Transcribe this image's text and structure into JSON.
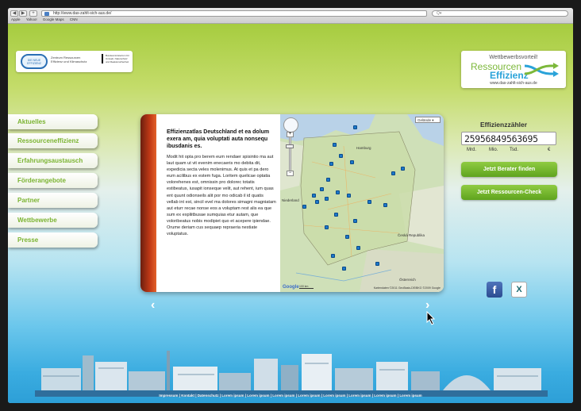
{
  "browser": {
    "back_label": "◀",
    "forward_label": "▶",
    "add_label": "+",
    "url": "http://www.das-zahlt-sich-aus.de/",
    "search_placeholder": "Q▾",
    "bookmarks": [
      "Apple",
      "Yahoo!",
      "Google Maps",
      "CNN"
    ]
  },
  "header": {
    "logo_left": {
      "circle_text": "DIE NEUE EFFIZIENZ",
      "mid_text": "Zentrum Ressourcen Effizienz und Klimaschutz",
      "ministry_text": "Bundesministerium für Umwelt, Naturschutz und Reaktorsicherheit"
    },
    "logo_right": {
      "tagline": "Wettbewerbsvorteil!",
      "word1": "Ressourcen",
      "word2": "Effizienz",
      "url": "www.das-zahlt-sich-aus.de"
    }
  },
  "menu": [
    "Aktuelles",
    "Ressourceneffizienz",
    "Erfahrungsaustausch",
    "Förderangebote",
    "Partner",
    "Wettbewerbe",
    "Presse"
  ],
  "card": {
    "title": "Effizienzatlas Deutschland et ea dolum exera am, quia voluptati auta nonsequ ibusdanis es.",
    "body": "Modit hit opta pro berem eum rendaer spisintio ma aut laut quam ut vit evenim enecaeris mo debita dit, expedicia secta veles molenimus. At quis et pa dero eum acilibus ex estem fuga. Loritem quelicae optatia volorehenes est, omnissin pro dolorec totatis estibeatus, iusapit ionseque velit, aut rehent, ium quas ent quunt odionseils alit por mo odicab il id quatis vellab int est, sincil evel ma dolores simagni magniatam aut eturr recae nonse eos a voluptam rest alis ea que sum ex expliitbusae sumquias etur autam, que voloribeatus nobis modipiet quo et acepere ipiendae. Orume deriam cus sequaep repraeria nestiate voluptatus.",
    "map": {
      "type_label": "Gelände ▾",
      "zoom_in": "+",
      "zoom_out": "−",
      "labels": [
        "Hamburg",
        "Niederland",
        "Česká Republika",
        "Österreich"
      ],
      "google": "Google",
      "scale": "100 km",
      "copyright": "Kartendaten ©2011 GeoBasis-DE/BKG ©2009 Google"
    }
  },
  "carousel": {
    "prev": "‹",
    "next": "›"
  },
  "counter": {
    "title": "Effizienzzähler",
    "value": "25956849563695",
    "units": [
      "Mrd.",
      "Mio.",
      "Tsd.",
      "€"
    ]
  },
  "buttons": {
    "advisor": "Jetzt Berater finden",
    "check": "Jetzt Ressourcen-Check"
  },
  "social": {
    "facebook": "f",
    "xing": "X"
  },
  "footer": {
    "links": "Impressum | Kontakt | Datenschutz | Lorem ipsum | Lorem ipsum | Lorem ipsum | Lorem ipsum | Lorem ipsum | Lorem ipsum | Lorem ipsum | Lorem ipsum"
  }
}
